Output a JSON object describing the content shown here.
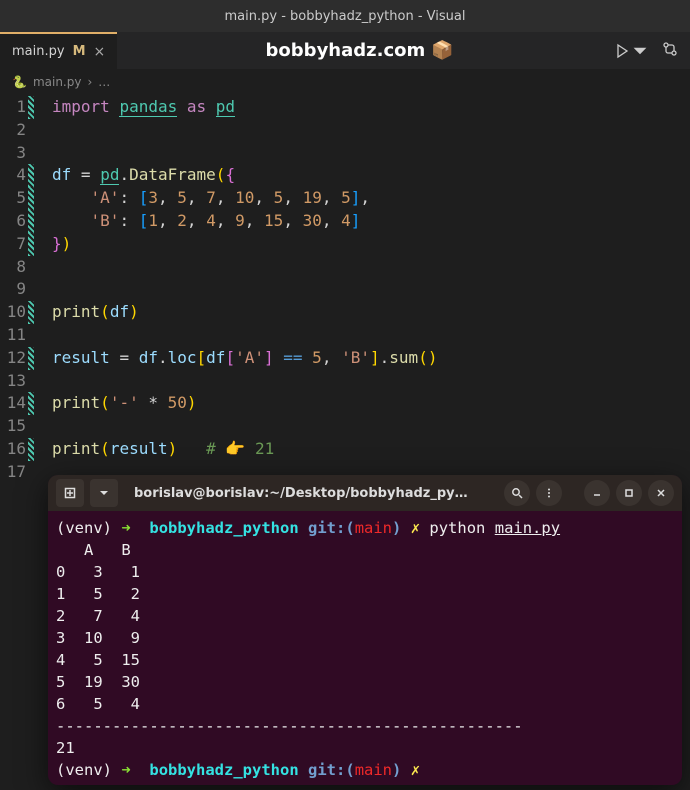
{
  "window": {
    "title": "main.py - bobbyhadz_python - Visual"
  },
  "tab": {
    "filename": "main.py",
    "modified_marker": "M",
    "close": "×"
  },
  "header_center": "bobbyhadz.com",
  "breadcrumb": {
    "file": "main.py",
    "sep": "›",
    "more": "…"
  },
  "gutter": [
    "1",
    "2",
    "3",
    "4",
    "5",
    "6",
    "7",
    "8",
    "9",
    "10",
    "11",
    "12",
    "13",
    "14",
    "15",
    "16",
    "17"
  ],
  "code": {
    "l1": {
      "import": "import",
      "pandas": "pandas",
      "as": "as",
      "pd": "pd"
    },
    "l4": {
      "df": "df",
      "eq": "=",
      "pd": "pd",
      "DataFrame": "DataFrame"
    },
    "l5": {
      "key": "'A'",
      "vals": [
        "3",
        "5",
        "7",
        "10",
        "5",
        "19",
        "5"
      ]
    },
    "l6": {
      "key": "'B'",
      "vals": [
        "1",
        "2",
        "4",
        "9",
        "15",
        "30",
        "4"
      ]
    },
    "l10": {
      "print": "print",
      "df": "df"
    },
    "l12": {
      "result": "result",
      "df": "df",
      "loc": "loc",
      "A": "'A'",
      "eq": "==",
      "five": "5",
      "B": "'B'",
      "sum": "sum"
    },
    "l14": {
      "print": "print",
      "dash": "'-'",
      "star": "*",
      "fifty": "50"
    },
    "l16": {
      "print": "print",
      "result": "result",
      "comment": "# 👉️ 21"
    }
  },
  "terminal": {
    "title": "borislav@borislav:~/Desktop/bobbyhadz_py…",
    "prompt": {
      "venv": "(venv)",
      "arrow": "➜",
      "dir": "bobbyhadz_python",
      "git": "git:(",
      "branch": "main",
      "gitclose": ")",
      "dirty": "✗",
      "python": "python",
      "file": "main.py"
    },
    "output": [
      "   A   B",
      "0   3   1",
      "1   5   2",
      "2   7   4",
      "3  10   9",
      "4   5  15",
      "5  19  30",
      "6   5   4",
      "--------------------------------------------------",
      "21"
    ]
  }
}
